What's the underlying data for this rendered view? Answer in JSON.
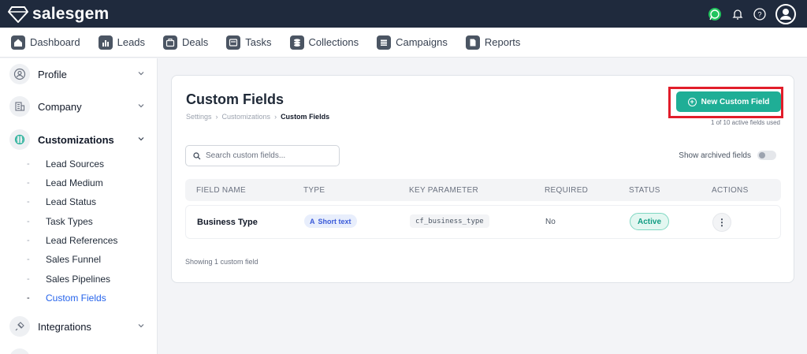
{
  "app": {
    "name": "salesgem",
    "brand_color": "#1f2a3d",
    "accent_color": "#1fae96"
  },
  "topbar": {
    "icons": [
      "whatsapp-icon",
      "bell-icon",
      "help-icon",
      "user-avatar"
    ]
  },
  "nav": {
    "items": [
      {
        "label": "Dashboard",
        "icon": "home-icon"
      },
      {
        "label": "Leads",
        "icon": "chart-icon"
      },
      {
        "label": "Deals",
        "icon": "briefcase-icon"
      },
      {
        "label": "Tasks",
        "icon": "tasks-icon"
      },
      {
        "label": "Collections",
        "icon": "coins-icon"
      },
      {
        "label": "Campaigns",
        "icon": "campaign-icon"
      },
      {
        "label": "Reports",
        "icon": "report-icon"
      }
    ]
  },
  "sidebar": {
    "groups": [
      {
        "label": "Profile",
        "icon": "profile-icon"
      },
      {
        "label": "Company",
        "icon": "building-icon"
      },
      {
        "label": "Customizations",
        "icon": "brain-icon",
        "expanded": true
      },
      {
        "label": "Integrations",
        "icon": "plug-icon"
      }
    ],
    "customization_items": [
      {
        "label": "Lead Sources"
      },
      {
        "label": "Lead Medium"
      },
      {
        "label": "Lead Status"
      },
      {
        "label": "Task Types"
      },
      {
        "label": "Lead References"
      },
      {
        "label": "Sales Funnel"
      },
      {
        "label": "Sales Pipelines"
      },
      {
        "label": "Custom Fields",
        "active": true
      }
    ]
  },
  "main": {
    "title": "Custom Fields",
    "breadcrumb": [
      "Settings",
      "Customizations",
      "Custom Fields"
    ],
    "breadcrumb_sep": "›",
    "new_button_label": "New Custom Field",
    "quota_text": "1 of 10 active fields used",
    "search_placeholder": "Search custom fields...",
    "archived_toggle_label": "Show archived fields",
    "archived_toggle_on": false,
    "columns": [
      "FIELD NAME",
      "TYPE",
      "KEY PARAMETER",
      "REQUIRED",
      "STATUS",
      "ACTIONS"
    ],
    "rows": [
      {
        "name": "Business Type",
        "type_icon": "A",
        "type": "Short text",
        "key": "cf_business_type",
        "required": "No",
        "status": "Active",
        "actions_icon": "⋮"
      }
    ],
    "footer_text": "Showing 1 custom field"
  }
}
